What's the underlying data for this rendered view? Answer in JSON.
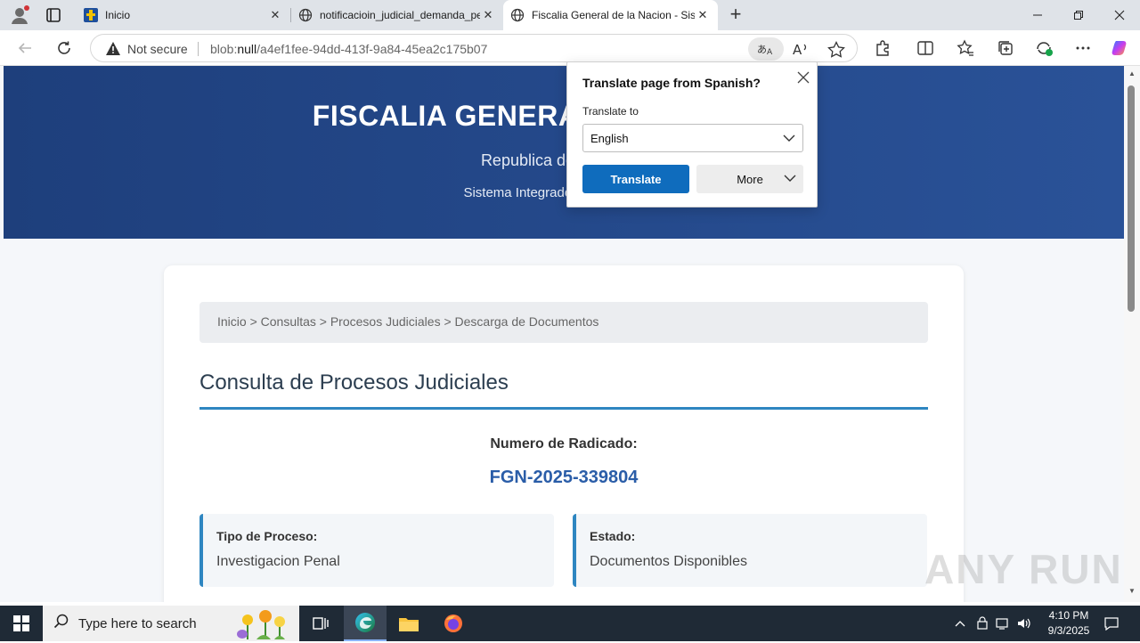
{
  "browser": {
    "tabs": [
      {
        "title": "Inicio",
        "active": false
      },
      {
        "title": "notificacioin_judicial_demanda_pe",
        "active": false
      },
      {
        "title": "Fiscalia General de la Nacion - Sis",
        "active": true
      }
    ],
    "address": {
      "security_label": "Not secure",
      "url_scheme": "blob:",
      "url_host": "null",
      "url_rest": "/a4ef1fee-94dd-413f-9a84-45ea2c175b07"
    }
  },
  "translate_popup": {
    "title": "Translate page from Spanish?",
    "label": "Translate to",
    "selected_language": "English",
    "translate_button": "Translate",
    "more_button": "More"
  },
  "page": {
    "hero": {
      "title": "FISCALIA GENERAL DE LA NACION",
      "subtitle": "Republica de Colombia",
      "subtitle2": "Sistema Integrado de Informacion"
    },
    "breadcrumb": "Inicio > Consultas > Procesos Judiciales > Descarga de Documentos",
    "title": "Consulta de Procesos Judiciales",
    "radicado_label": "Numero de Radicado:",
    "radicado_value": "FGN-2025-339804",
    "info": [
      {
        "label": "Tipo de Proceso:",
        "value": "Investigacion Penal"
      },
      {
        "label": "Estado:",
        "value": "Documentos Disponibles"
      }
    ]
  },
  "watermark": "ANY RUN",
  "taskbar": {
    "search_placeholder": "Type here to search",
    "time": "4:10 PM",
    "date": "9/3/2025"
  },
  "colors": {
    "hero_start": "#1e3f7c",
    "hero_end": "#2a5298",
    "accent": "#2e86c1",
    "radicado": "#2a5da8",
    "translate_button": "#0f6cbd"
  }
}
